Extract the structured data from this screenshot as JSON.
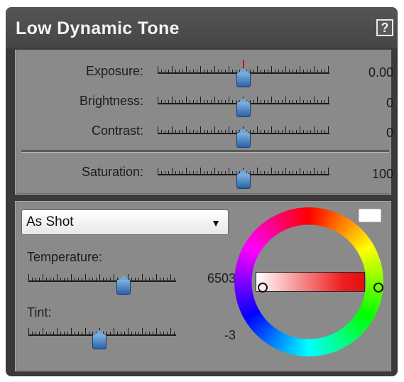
{
  "panel": {
    "title": "Low Dynamic Tone",
    "help_label": "?"
  },
  "tone": {
    "sliders": [
      {
        "label": "Exposure:",
        "value": "0.00",
        "level": 0.5
      },
      {
        "label": "Brightness:",
        "value": "0",
        "level": 0.5
      },
      {
        "label": "Contrast:",
        "value": "0",
        "level": 0.5
      }
    ],
    "saturation": {
      "label": "Saturation:",
      "value": "100",
      "level": 0.5
    }
  },
  "white_balance": {
    "preset": {
      "selected": "As Shot"
    },
    "temperature": {
      "label": "Temperature:",
      "value": "6503",
      "level": 0.63
    },
    "tint": {
      "label": "Tint:",
      "value": "-3",
      "level": 0.47
    }
  },
  "colors": {
    "accent": "#2a63a8",
    "center_mark": "#c61818",
    "panel_bg": "#3a3a3a",
    "section_bg": "#8a8a8a"
  }
}
